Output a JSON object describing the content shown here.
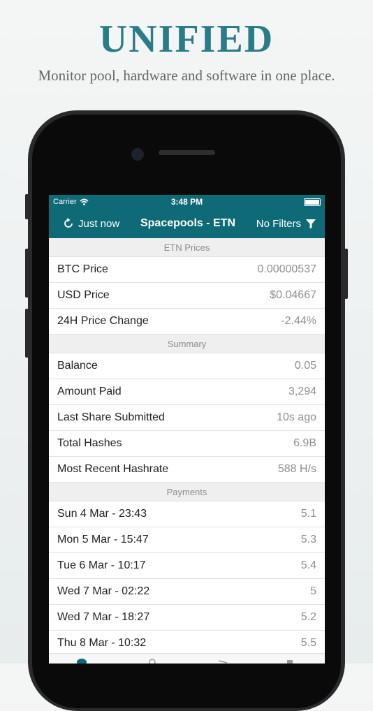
{
  "headline": "UNIFIED",
  "subline": "Monitor pool, hardware and software in one place.",
  "status_bar": {
    "carrier": "Carrier",
    "time": "3:48 PM"
  },
  "nav": {
    "refresh_label": "Just now",
    "title": "Spacepools - ETN",
    "filter_label": "No Filters"
  },
  "sections": [
    {
      "header": "ETN Prices",
      "rows": [
        {
          "label": "BTC Price",
          "value": "0.00000537"
        },
        {
          "label": "USD Price",
          "value": "$0.04667"
        },
        {
          "label": "24H Price Change",
          "value": "-2.44%"
        }
      ]
    },
    {
      "header": "Summary",
      "rows": [
        {
          "label": "Balance",
          "value": "0.05"
        },
        {
          "label": "Amount Paid",
          "value": "3,294"
        },
        {
          "label": "Last Share Submitted",
          "value": "10s ago"
        },
        {
          "label": "Total Hashes",
          "value": "6.9B"
        },
        {
          "label": "Most Recent Hashrate",
          "value": "588 H/s"
        }
      ]
    },
    {
      "header": "Payments",
      "rows": [
        {
          "label": "Sun 4 Mar - 23:43",
          "value": "5.1"
        },
        {
          "label": "Mon 5 Mar - 15:47",
          "value": "5.3"
        },
        {
          "label": "Tue 6 Mar - 10:17",
          "value": "5.4"
        },
        {
          "label": "Wed 7 Mar - 02:22",
          "value": "5"
        },
        {
          "label": "Wed 7 Mar - 18:27",
          "value": "5.2"
        },
        {
          "label": "Thu 8 Mar - 10:32",
          "value": "5.5"
        }
      ]
    }
  ],
  "colors": {
    "accent": "#0f6a77",
    "headline": "#2a7c88"
  },
  "icons": {
    "refresh": "refresh-icon",
    "filter": "filter-icon",
    "wifi": "wifi-icon",
    "battery": "battery-icon"
  }
}
